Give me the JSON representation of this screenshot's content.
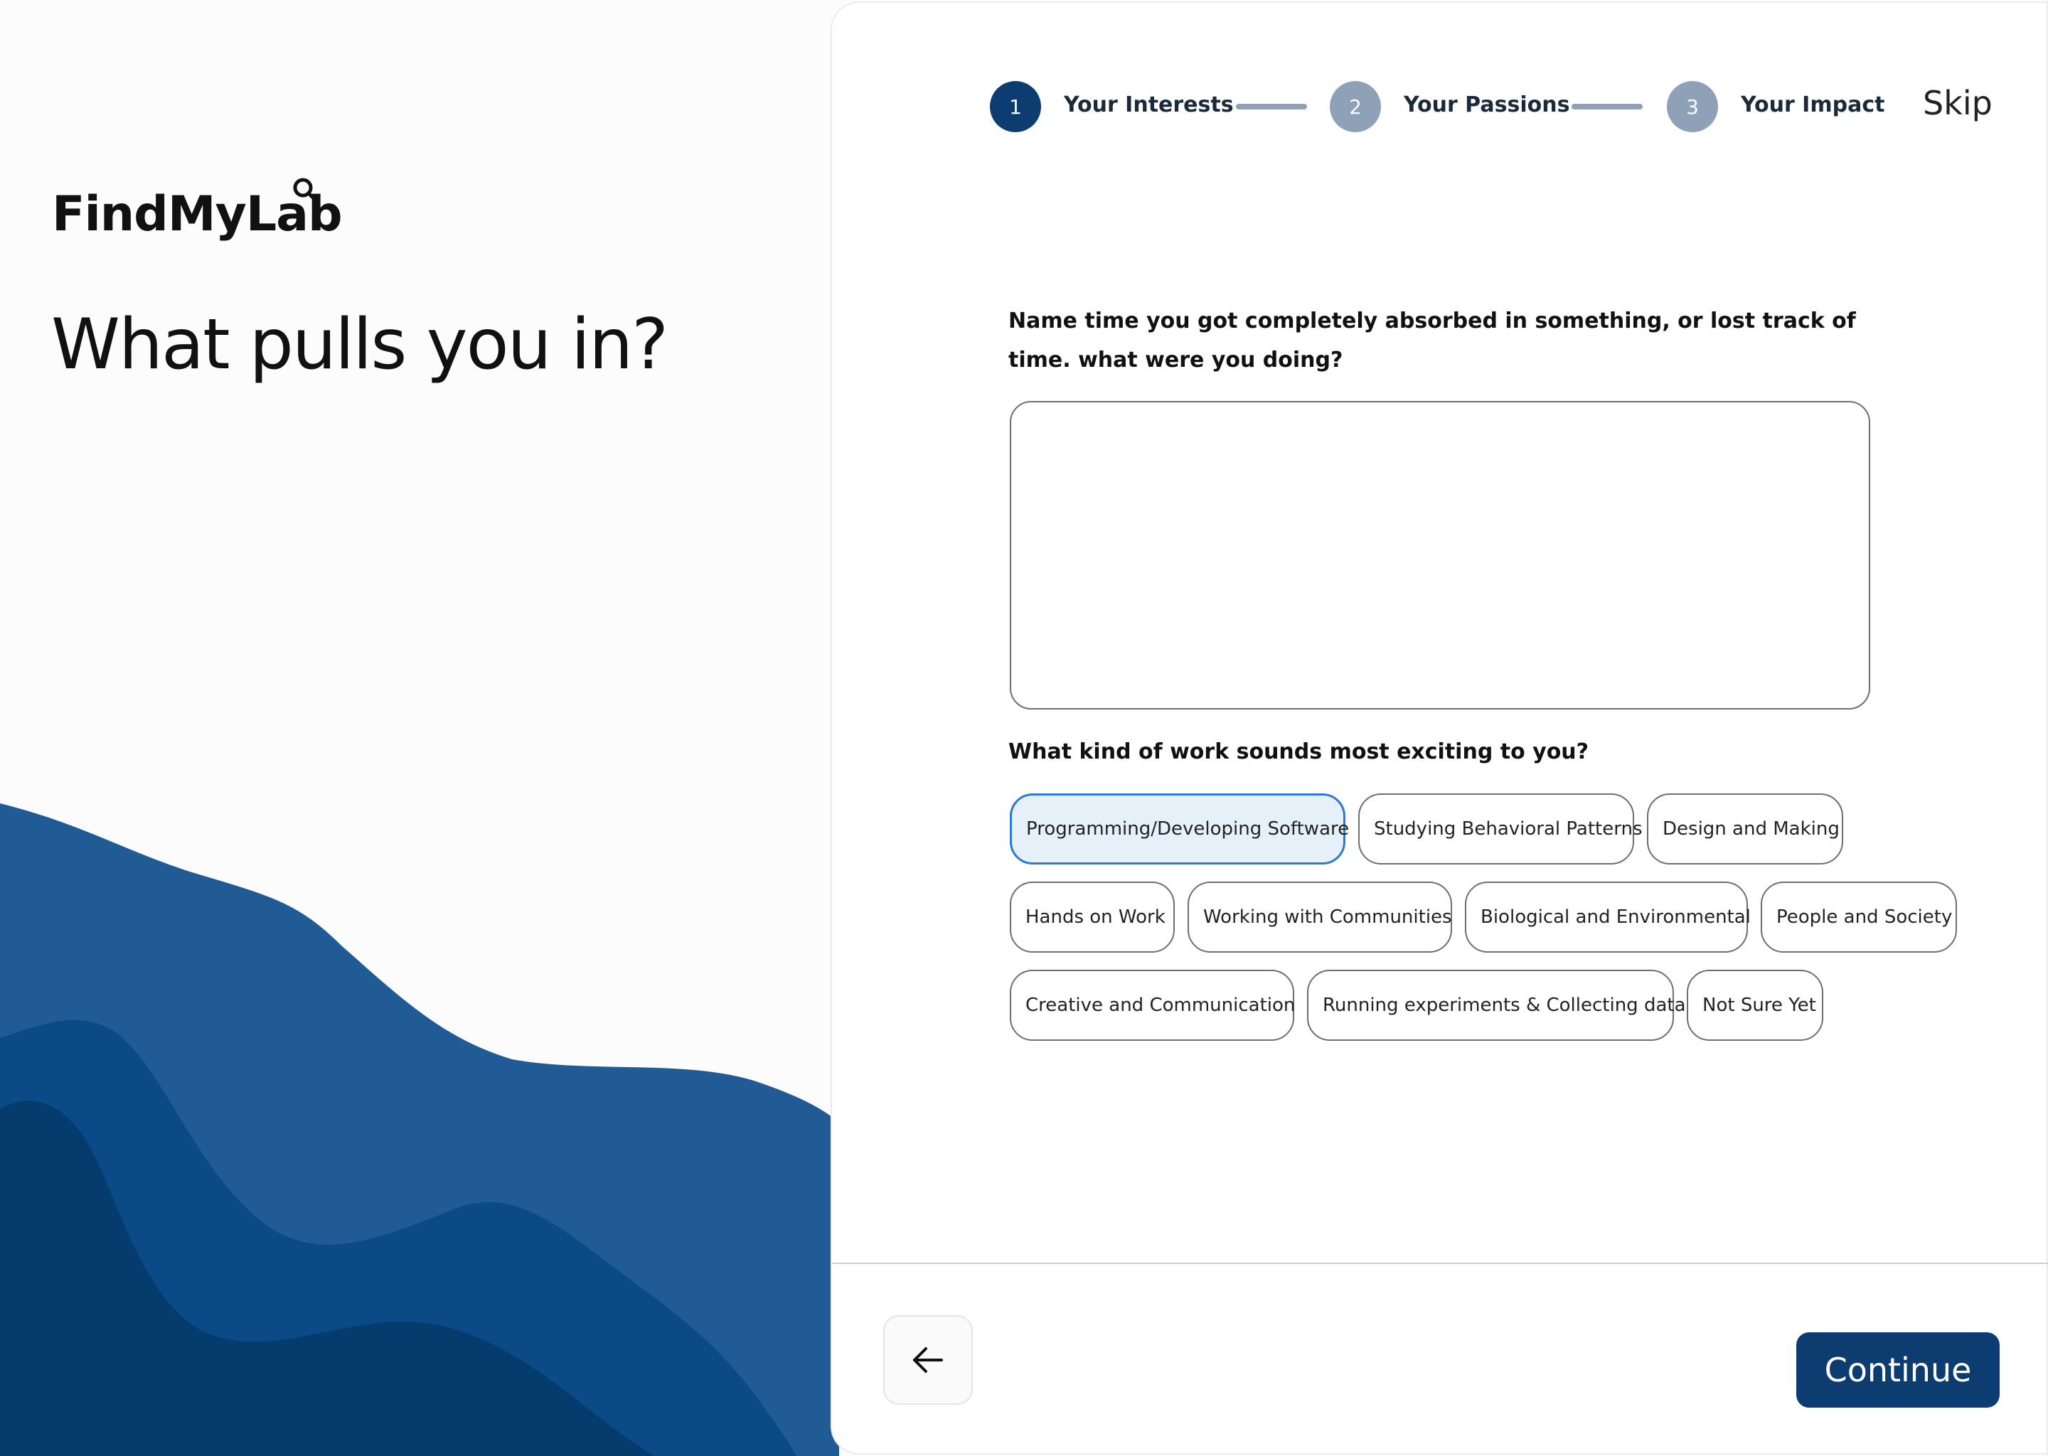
{
  "brand": {
    "name": "FindMyLab",
    "logo_icon": "search-icon"
  },
  "hero": {
    "headline": "What pulls you in?"
  },
  "stepper": {
    "steps": [
      {
        "number": "1",
        "label": "Your Interests",
        "state": "active"
      },
      {
        "number": "2",
        "label": "Your Passions",
        "state": "inactive"
      },
      {
        "number": "3",
        "label": "Your Impact",
        "state": "inactive"
      }
    ],
    "skip_label": "Skip"
  },
  "form": {
    "question_1": "Name time you got completely absorbed in something, or lost track of time. what were you doing?",
    "answer_1_value": "",
    "question_2": "What kind of work sounds most exciting to you?",
    "options": [
      {
        "label": "Programming/Developing Software",
        "selected": true
      },
      {
        "label": "Studying Behavioral Patterns",
        "selected": false
      },
      {
        "label": "Design and Making",
        "selected": false
      },
      {
        "label": "Hands on Work",
        "selected": false
      },
      {
        "label": "Working with Communities",
        "selected": false
      },
      {
        "label": "Biological and Environmental",
        "selected": false
      },
      {
        "label": "People and Society",
        "selected": false
      },
      {
        "label": "Creative and Communication",
        "selected": false
      },
      {
        "label": "Running experiments & Collecting data",
        "selected": false
      },
      {
        "label": "Not Sure Yet",
        "selected": false
      }
    ]
  },
  "footer": {
    "back_icon": "arrow-left-icon",
    "continue_label": "Continue"
  },
  "colors": {
    "primary_navy": "#0d3d70",
    "step_inactive": "#8ea1b6",
    "chip_selected_bg": "#e6f0f9",
    "chip_selected_border": "#2a7ad6",
    "wave_light": "#215b96",
    "wave_mid": "#0b4a87",
    "wave_dark": "#053c6e"
  }
}
